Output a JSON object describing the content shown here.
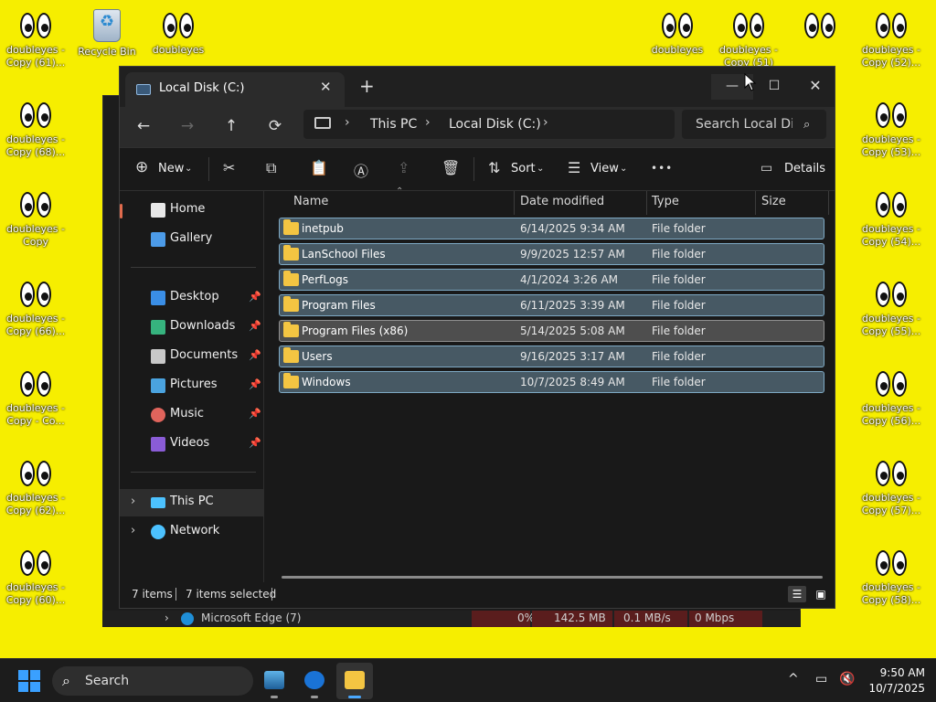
{
  "desktop": {
    "icons": [
      {
        "label": "doubleyes - Copy (61)..."
      },
      {
        "label": "Recycle Bin"
      },
      {
        "label": "doubleyes"
      },
      {
        "label": "doubleyes"
      },
      {
        "label": "doubleyes - Copy (51)"
      },
      {
        "label": "doubleyes - Copy (52)..."
      },
      {
        "label": "doubleyes - Copy (68)..."
      },
      {
        "label": "doubleyes - Copy (53)..."
      },
      {
        "label": "doubleyes - Copy"
      },
      {
        "label": "doubleyes - Copy (54)..."
      },
      {
        "label": "doubleyes - Copy (66)..."
      },
      {
        "label": "doubleyes - Copy (55)..."
      },
      {
        "label": "doubleyes - Copy - Co..."
      },
      {
        "label": "doubleyes - Copy (56)..."
      },
      {
        "label": "doubleyes - Copy (62)..."
      },
      {
        "label": "doubleyes - Copy (57)..."
      },
      {
        "label": "doubleyes - Copy (60)..."
      },
      {
        "label": "doubleyes - Copy (58)..."
      }
    ]
  },
  "bg_window": {
    "row_name": "Microsoft Edge (7)",
    "cpu": "0%",
    "memory": "142.5 MB",
    "disk": "0.1 MB/s",
    "network": "0 Mbps"
  },
  "explorer": {
    "tab_title": "Local Disk (C:)",
    "tab_close": "✕",
    "tab_add": "+",
    "win_min": "—",
    "win_max": "☐",
    "win_close": "✕",
    "nav": {
      "back": "←",
      "forward": "→",
      "up": "↑",
      "refresh": "⟳"
    },
    "address": {
      "crumbs": [
        "This PC",
        "Local Disk (C:)"
      ]
    },
    "search": {
      "placeholder": "Search Local Dis"
    },
    "commands": {
      "new_label": "New",
      "sort_label": "Sort",
      "view_label": "View",
      "details_label": "Details",
      "more": "•••"
    },
    "sidebar": {
      "items": [
        {
          "label": "Home",
          "color": "#e8e8e8"
        },
        {
          "label": "Gallery",
          "color": "#4c9be8"
        },
        {
          "label": "Desktop",
          "color": "#3a8ee6"
        },
        {
          "label": "Downloads",
          "color": "#36b37e"
        },
        {
          "label": "Documents",
          "color": "#c8c8c8"
        },
        {
          "label": "Pictures",
          "color": "#4aa3df"
        },
        {
          "label": "Music",
          "color": "#e0645c"
        },
        {
          "label": "Videos",
          "color": "#8a5cd6"
        },
        {
          "label": "This PC",
          "color": "#4cc2ff"
        },
        {
          "label": "Network",
          "color": "#4cc2ff"
        }
      ]
    },
    "columns": {
      "name": "Name",
      "date": "Date modified",
      "type": "Type",
      "size": "Size"
    },
    "files": [
      {
        "name": "inetpub",
        "date": "6/14/2025 9:34 AM",
        "type": "File folder"
      },
      {
        "name": "LanSchool Files",
        "date": "9/9/2025 12:57 AM",
        "type": "File folder"
      },
      {
        "name": "PerfLogs",
        "date": "4/1/2024 3:26 AM",
        "type": "File folder"
      },
      {
        "name": "Program Files",
        "date": "6/11/2025 3:39 AM",
        "type": "File folder"
      },
      {
        "name": "Program Files (x86)",
        "date": "5/14/2025 5:08 AM",
        "type": "File folder"
      },
      {
        "name": "Users",
        "date": "9/16/2025 3:17 AM",
        "type": "File folder"
      },
      {
        "name": "Windows",
        "date": "10/7/2025 8:49 AM",
        "type": "File folder"
      }
    ],
    "status": {
      "items": "7 items",
      "selected": "7 items selected"
    }
  },
  "taskbar": {
    "search_label": "Search",
    "time": "9:50 AM",
    "date": "10/7/2025"
  },
  "colors": {
    "desktop_bg": "#f6ee00",
    "selection_bg": "#475964",
    "selection_border": "#7ea9c4",
    "folder": "#f4c542",
    "accent": "#3aa0ff"
  }
}
